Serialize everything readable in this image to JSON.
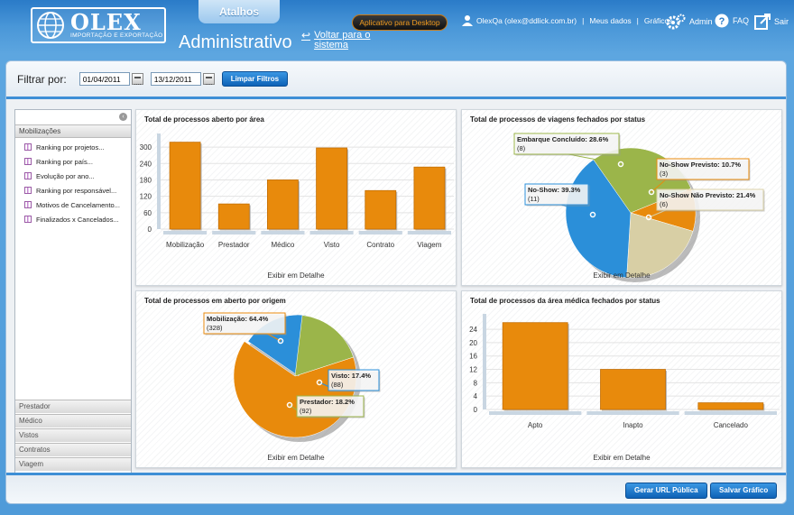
{
  "header": {
    "logo_text": "OLEX",
    "logo_subtext": "IMPORTAÇÃO E EXPORTAÇÃO",
    "shortcuts_tab": "Atalhos",
    "page_title": "Administrativo",
    "back_link_line1": "Voltar para o",
    "back_link_line2": "sistema",
    "desktop_app_button": "Aplicativo para Desktop",
    "user": "OlexQa (olex@ddlick.com.br)",
    "my_data_link": "Meus dados",
    "charts_link": "Gráficos",
    "admin_label": "Admin",
    "faq_label": "FAQ",
    "logout_label": "Sair"
  },
  "filter": {
    "label": "Filtrar por:",
    "date_from": "01/04/2011",
    "date_to": "13/12/2011",
    "clear_button": "Limpar Filtros"
  },
  "sidebar": {
    "open_section": "Mobilizações",
    "items": [
      {
        "label": "Ranking por projetos..."
      },
      {
        "label": "Ranking por país..."
      },
      {
        "label": "Evolução por ano..."
      },
      {
        "label": "Ranking por responsável..."
      },
      {
        "label": "Motivos de Cancelamento..."
      },
      {
        "label": "Finalizados x Cancelados..."
      }
    ],
    "collapsed_sections": [
      "Prestador",
      "Médico",
      "Vistos",
      "Contratos",
      "Viagem"
    ]
  },
  "detail_label": "Exibir em Detalhe",
  "footer": {
    "public_url_button": "Gerar URL Pública",
    "save_chart_button": "Salvar Gráfico"
  },
  "colors": {
    "orange": "#e88a0c",
    "green": "#9bb54a",
    "blue": "#2b8fd9",
    "beige": "#d8cfa5",
    "header_blue": "#2a7bc8"
  },
  "chart_data": [
    {
      "type": "bar",
      "title": "Total de processos aberto por área",
      "categories": [
        "Mobilização",
        "Prestador",
        "Médico",
        "Visto",
        "Contrato",
        "Viagem"
      ],
      "values": [
        318,
        92,
        180,
        297,
        141,
        227
      ],
      "yticks": [
        0,
        60,
        120,
        180,
        240,
        300
      ],
      "ylim": [
        0,
        330
      ]
    },
    {
      "type": "pie",
      "title": "Total de processos de viagens fechados por status",
      "slices": [
        {
          "name": "Embarque Concluído",
          "percent": "28.6%",
          "count": "(8)",
          "value": 8,
          "color": "#9bb54a"
        },
        {
          "name": "No-Show Previsto",
          "percent": "10.7%",
          "count": "(3)",
          "value": 3,
          "color": "#e88a0c"
        },
        {
          "name": "No-Show Não Previsto",
          "percent": "21.4%",
          "count": "(6)",
          "value": 6,
          "color": "#d8cfa5"
        },
        {
          "name": "No-Show",
          "percent": "39.3%",
          "count": "(11)",
          "value": 11,
          "color": "#2b8fd9"
        }
      ]
    },
    {
      "type": "pie",
      "title": "Total de processos em aberto por origem",
      "slices": [
        {
          "name": "Mobilização",
          "percent": "64.4%",
          "count": "(328)",
          "value": 328,
          "color": "#e88a0c"
        },
        {
          "name": "Visto",
          "percent": "17.4%",
          "count": "(88)",
          "value": 88,
          "color": "#2b8fd9"
        },
        {
          "name": "Prestador",
          "percent": "18.2%",
          "count": "(92)",
          "value": 92,
          "color": "#9bb54a"
        }
      ]
    },
    {
      "type": "bar",
      "title": "Total de processos da área médica fechados por status",
      "categories": [
        "Apto",
        "Inapto",
        "Cancelado"
      ],
      "values": [
        26,
        12,
        2
      ],
      "yticks": [
        0,
        4,
        8,
        12,
        16,
        20,
        24
      ],
      "ylim": [
        0,
        27
      ]
    }
  ]
}
